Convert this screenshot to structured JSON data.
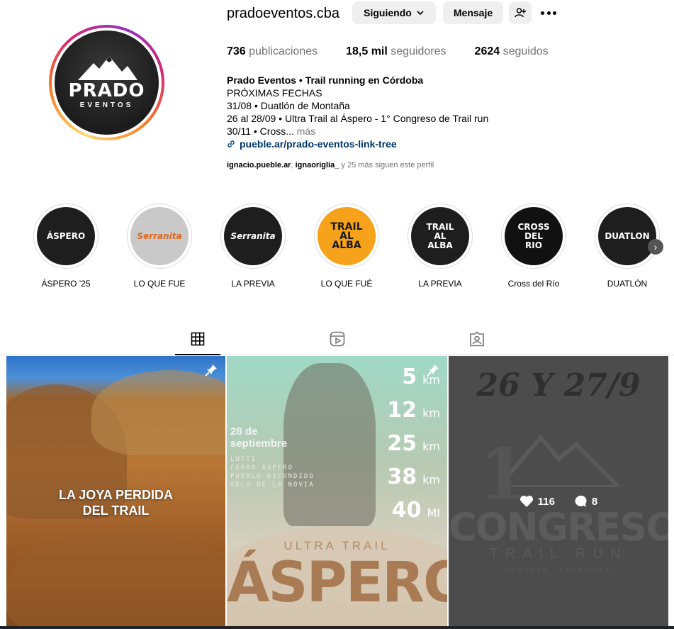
{
  "profile": {
    "username": "pradoeventos.cba",
    "avatar_text": "PRADO",
    "avatar_sub": "EVENTOS",
    "following_label": "Siguiendo",
    "message_label": "Mensaje",
    "stats": {
      "posts_count": "736",
      "posts_label": "publicaciones",
      "followers_count": "18,5 mil",
      "followers_label": "seguidores",
      "following_count": "2624",
      "following_label": "seguidos"
    },
    "bio": {
      "name": "Prado Eventos • Trail running en Córdoba",
      "line1": "PRÓXIMAS FECHAS",
      "line2": "31/08 • Duatlón de Montaña",
      "line3": "26 al 28/09 • Ultra Trail al Áspero - 1° Congreso de Trail run",
      "line4": "30/11 • Cross...",
      "more": "más",
      "link": "pueble.ar/prado-eventos-link-tree"
    },
    "followed_by": {
      "user1": "ignacio.pueble.ar",
      "sep": ", ",
      "user2": "ignaoriglia_",
      "rest": " y 25 más siguen este perfil"
    }
  },
  "highlights": [
    {
      "label": "ÁSPERO '25",
      "art": "ÁSPERO",
      "bg": "#1e1e1e"
    },
    {
      "label": "LO QUE FUE",
      "art": "Serranita",
      "bg": "#c9c9c9"
    },
    {
      "label": "LA PREVIA",
      "art": "Serranita",
      "bg": "#1e1e1e"
    },
    {
      "label": "LO QUE FUÉ",
      "art": "TRAIL AL ALBA",
      "bg": "#f7a21b"
    },
    {
      "label": "LA PREVIA",
      "art": "TRAIL AL ALBA",
      "bg": "#1e1e1e"
    },
    {
      "label": "Cross del Río",
      "art": "CROSS DEL RIO",
      "bg": "#111111"
    },
    {
      "label": "DUATLÓN",
      "art": "DUATLON",
      "bg": "#1e1e1e"
    }
  ],
  "posts": {
    "p1": {
      "title_line1": "LA JOYA PERDIDA",
      "title_line2": "DEL TRAIL"
    },
    "p2": {
      "date_line1": "28 de",
      "date_line2": "septiembre",
      "places": [
        "LUTTI",
        "CERRO ÁSPERO",
        "PUEBLO ESCONDIDO",
        "VELO DE LA NOVIA"
      ],
      "distances": [
        {
          "value": "5",
          "unit": "km"
        },
        {
          "value": "12",
          "unit": "km"
        },
        {
          "value": "25",
          "unit": "km"
        },
        {
          "value": "38",
          "unit": "km"
        },
        {
          "value": "40",
          "unit": "MI"
        }
      ],
      "ultra": "ULTRA TRAIL",
      "big": "ÁSPERO"
    },
    "p3": {
      "date": "26 Y 27/9",
      "one": "1",
      "congreso": "CONGRESO",
      "trail_run": "TRAIL RUN",
      "location": "CÓRDOBA - ARGENTINA",
      "likes": "116",
      "comments": "8"
    }
  },
  "colors": {
    "link": "#00376b",
    "muted": "#737373",
    "button_bg": "#efefef"
  }
}
